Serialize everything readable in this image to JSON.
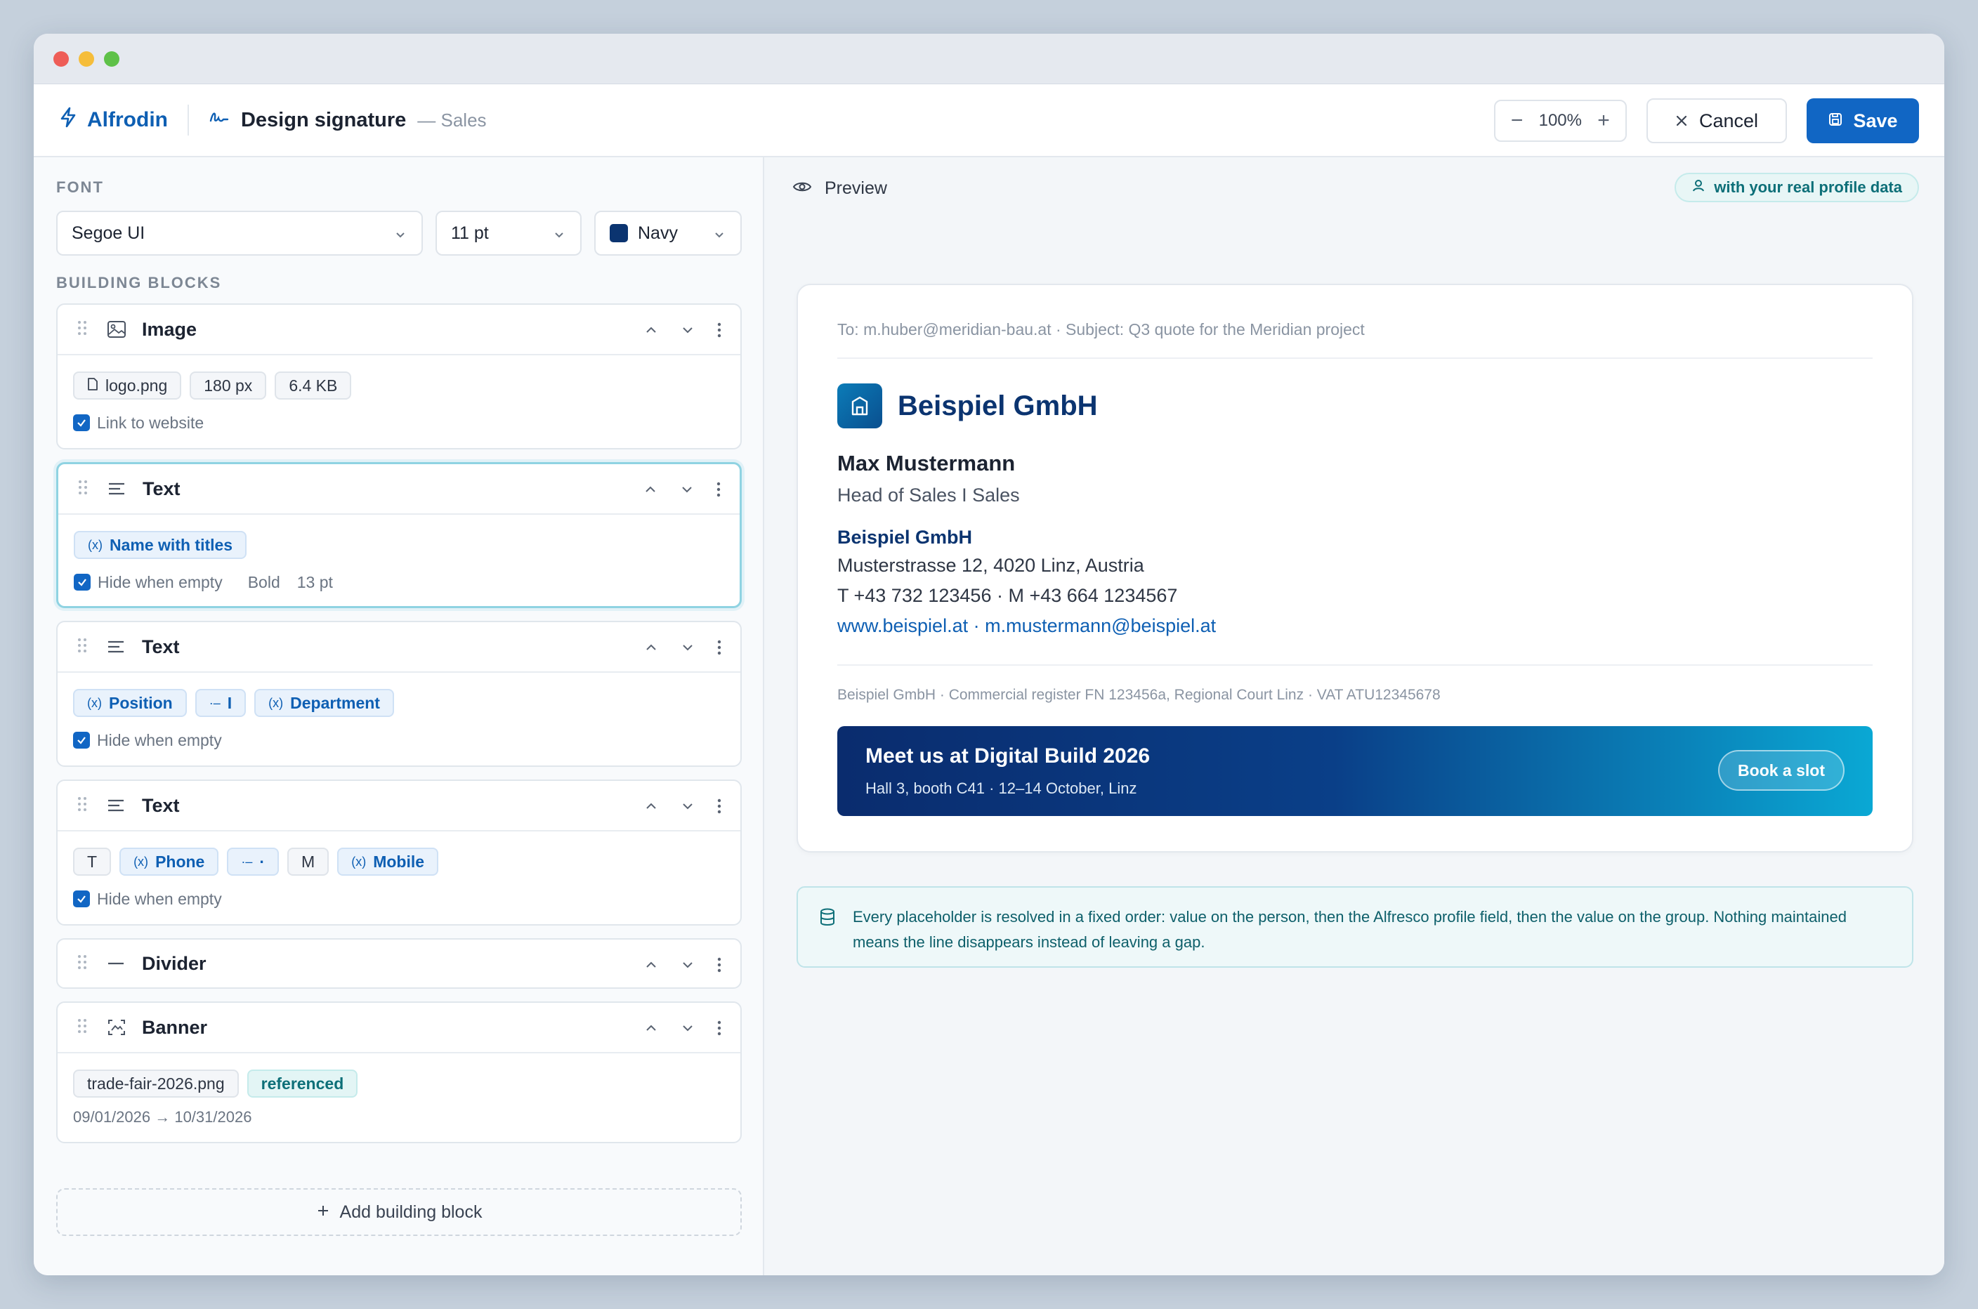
{
  "app": {
    "name": "Alfrodin"
  },
  "page": {
    "title": "Design signature",
    "subtitle": "— Sales"
  },
  "toolbar": {
    "zoom": "100%",
    "cancel_label": "Cancel",
    "save_label": "Save"
  },
  "font_section": {
    "label": "FONT",
    "family": "Segoe UI",
    "size": "11 pt",
    "color_label": "Navy",
    "color_hex": "#0b3470"
  },
  "blocks_section": {
    "label": "BUILDING BLOCKS",
    "add_label": "Add building block"
  },
  "blocks": {
    "image": {
      "title": "Image",
      "chips": [
        "logo.png",
        "180 px",
        "6.4 KB"
      ],
      "option": "Link to website"
    },
    "text_name": {
      "title": "Text",
      "chips": [
        "Name with titles"
      ],
      "option": "Hide when empty",
      "meta": [
        "Bold",
        "13 pt"
      ]
    },
    "text_position": {
      "title": "Text",
      "chips": [
        "Position",
        "I",
        "Department"
      ],
      "option": "Hide when empty"
    },
    "text_phone": {
      "title": "Text",
      "chips": [
        "T",
        "Phone",
        "·",
        "M",
        "Mobile"
      ],
      "option": "Hide when empty"
    },
    "divider": {
      "title": "Divider"
    },
    "banner": {
      "title": "Banner",
      "chips": [
        "trade-fair-2026.png",
        "referenced"
      ],
      "dates": "09/01/2026 → 10/31/2026"
    }
  },
  "preview": {
    "label": "Preview",
    "real_data_label": "with your real profile data",
    "mail_meta": "To: m.huber@meridian-bau.at  ·  Subject: Q3 quote for the Meridian project",
    "company_logo_text": "Beispiel GmbH",
    "name": "Max Mustermann",
    "role": "Head of Sales I Sales",
    "company": "Beispiel GmbH",
    "address": "Musterstrasse 12, 4020 Linz, Austria",
    "phones": "T +43 732 123456 · M +43 664 1234567",
    "links": "www.beispiel.at · m.mustermann@beispiel.at",
    "legal": "Beispiel GmbH · Commercial register FN 123456a, Regional Court Linz · VAT ATU12345678",
    "banner": {
      "title": "Meet us at Digital Build 2026",
      "subtitle": "Hall 3, booth C41 · 12–14 October, Linz",
      "button": "Book a slot"
    }
  },
  "info_note": "Every placeholder is resolved in a fixed order: value on the person, then the Alfresco profile field, then the value on the group. Nothing maintained means the line disappears instead of leaving a gap.",
  "colors": {
    "accent": "#1166c4",
    "navy": "#0b3470",
    "teal": "#0d6f78"
  }
}
